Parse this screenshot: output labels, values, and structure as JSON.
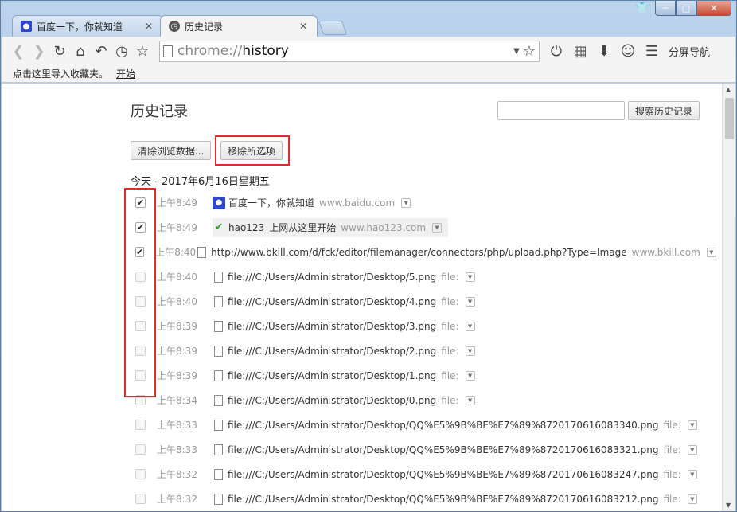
{
  "window": {
    "title_controls": [
      "shirt-icon",
      "minimize",
      "maximize",
      "close"
    ]
  },
  "tabs": [
    {
      "label": "百度一下，你就知道",
      "icon": "baidu-paw-icon",
      "active": false
    },
    {
      "label": "历史记录",
      "icon": "history-clock-icon",
      "active": true
    }
  ],
  "toolbar": {
    "url_scheme": "chrome://",
    "url_path": "history",
    "split_label": "分屏导航"
  },
  "bookmarks_bar": {
    "import_text": "点击这里导入收藏夹。",
    "start_link": "开始"
  },
  "page": {
    "title": "历史记录",
    "search_placeholder": "",
    "search_button": "搜索历史记录",
    "clear_button": "清除浏览数据...",
    "remove_button": "移除所选项",
    "date_heading": "今天 - 2017年6月16日星期五"
  },
  "entries": [
    {
      "checked": true,
      "time": "上午8:49",
      "favicon": "baidu",
      "title": "百度一下，你就知道",
      "domain": "www.baidu.com"
    },
    {
      "checked": true,
      "time": "上午8:49",
      "favicon": "hao123",
      "title": "hao123_上网从这里开始",
      "domain": "www.hao123.com"
    },
    {
      "checked": true,
      "time": "上午8:40",
      "favicon": "doc",
      "title": "http://www.bkill.com/d/fck/editor/filemanager/connectors/php/upload.php?Type=Image",
      "domain": "www.bkill.com"
    },
    {
      "checked": false,
      "time": "上午8:40",
      "favicon": "doc",
      "title": "file:///C:/Users/Administrator/Desktop/5.png",
      "domain": "file:"
    },
    {
      "checked": false,
      "time": "上午8:40",
      "favicon": "doc",
      "title": "file:///C:/Users/Administrator/Desktop/4.png",
      "domain": "file:"
    },
    {
      "checked": false,
      "time": "上午8:39",
      "favicon": "doc",
      "title": "file:///C:/Users/Administrator/Desktop/3.png",
      "domain": "file:"
    },
    {
      "checked": false,
      "time": "上午8:39",
      "favicon": "doc",
      "title": "file:///C:/Users/Administrator/Desktop/2.png",
      "domain": "file:"
    },
    {
      "checked": false,
      "time": "上午8:39",
      "favicon": "doc",
      "title": "file:///C:/Users/Administrator/Desktop/1.png",
      "domain": "file:"
    },
    {
      "checked": false,
      "time": "上午8:34",
      "favicon": "doc",
      "title": "file:///C:/Users/Administrator/Desktop/0.png",
      "domain": "file:"
    },
    {
      "checked": false,
      "time": "上午8:33",
      "favicon": "doc",
      "title": "file:///C:/Users/Administrator/Desktop/QQ%E5%9B%BE%E7%89%8720170616083340.png",
      "domain": "file:"
    },
    {
      "checked": false,
      "time": "上午8:33",
      "favicon": "doc",
      "title": "file:///C:/Users/Administrator/Desktop/QQ%E5%9B%BE%E7%89%8720170616083321.png",
      "domain": "file:"
    },
    {
      "checked": false,
      "time": "上午8:32",
      "favicon": "doc",
      "title": "file:///C:/Users/Administrator/Desktop/QQ%E5%9B%BE%E7%89%8720170616083247.png",
      "domain": "file:"
    },
    {
      "checked": false,
      "time": "上午8:32",
      "favicon": "doc",
      "title": "file:///C:/Users/Administrator/Desktop/QQ%E5%9B%BE%E7%89%8720170616083212.png",
      "domain": "file:"
    }
  ],
  "highlight_color": "#e02b2b"
}
